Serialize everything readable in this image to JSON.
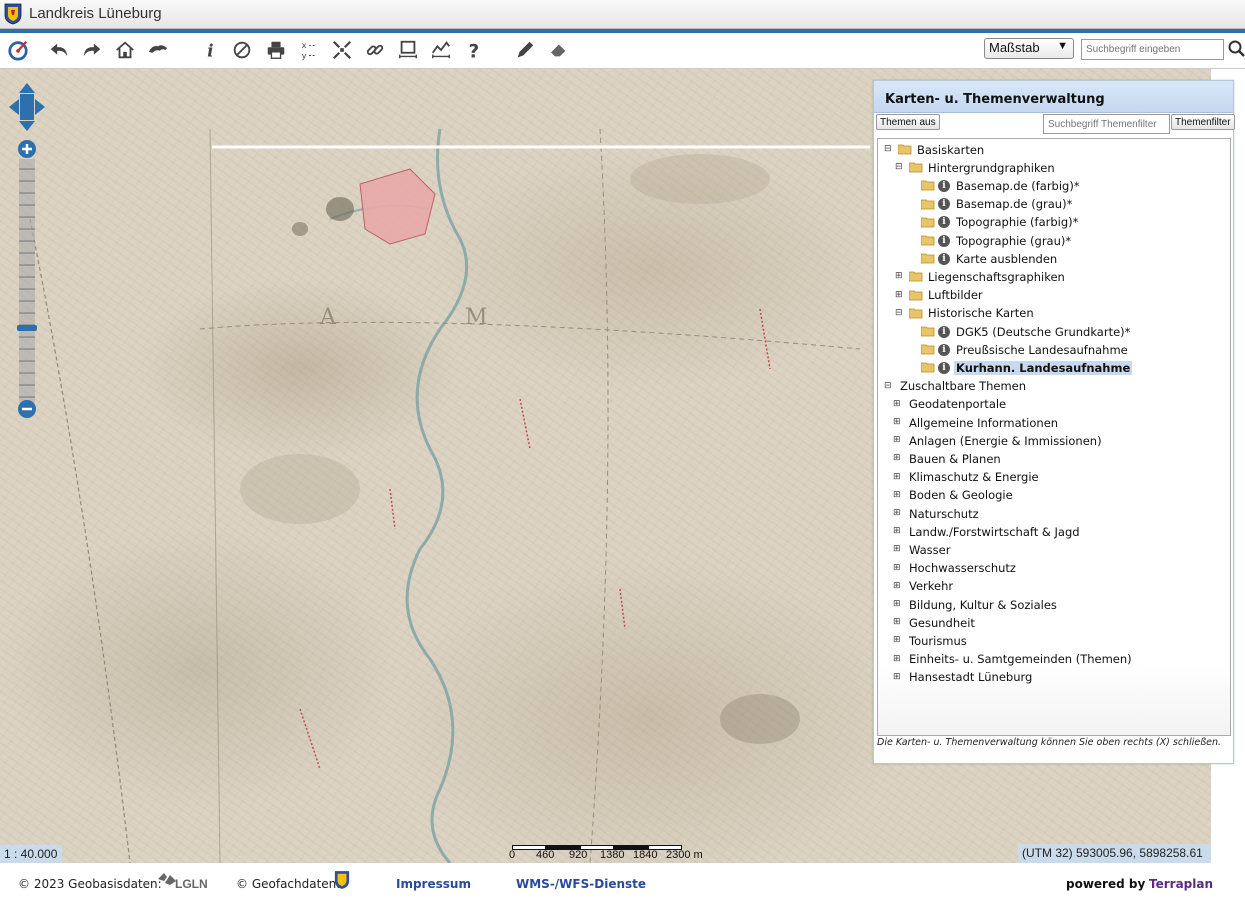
{
  "app": {
    "title": "Landkreis Lüneburg"
  },
  "toolbar": {
    "icons": [
      "logo-icon",
      "undo-icon",
      "redo-icon",
      "home-icon",
      "pan-icon",
      "info-icon",
      "clear-icon",
      "print-icon",
      "coordinates-icon",
      "fullextent-icon",
      "link-icon",
      "measure-area-icon",
      "measure-profile-icon",
      "help-icon",
      "draw-icon",
      "erase-icon"
    ],
    "scale_select": "Maßstab",
    "search_placeholder": "Suchbegriff eingeben"
  },
  "map": {
    "scale_ratio": "1 : 40.000",
    "coords": "(UTM 32) 593005.96, 5898258.61",
    "scalebar": {
      "labels": [
        "0",
        "460",
        "920",
        "1380",
        "1840",
        "2300 m"
      ]
    }
  },
  "panel": {
    "title": "Karten- u. Themenverwaltung",
    "btn_themes_off": "Themen aus",
    "filter_placeholder": "Suchbegriff Themenfilter",
    "btn_filter": "Themenfilter",
    "tree": [
      {
        "label": "Basiskarten"
      },
      {
        "label": "Hintergrundgraphiken"
      },
      {
        "label": "Basemap.de (farbig)*"
      },
      {
        "label": "Basemap.de (grau)*"
      },
      {
        "label": "Topographie (farbig)*"
      },
      {
        "label": "Topographie (grau)*"
      },
      {
        "label": "Karte ausblenden"
      },
      {
        "label": "Liegenschaftsgraphiken"
      },
      {
        "label": "Luftbilder"
      },
      {
        "label": "Historische Karten"
      },
      {
        "label": "DGK5 (Deutsche Grundkarte)*"
      },
      {
        "label": "Preußsische Landesaufnahme"
      },
      {
        "label": "Kurhann. Landesaufnahme"
      },
      {
        "label": "Zuschaltbare Themen"
      },
      {
        "label": "Geodatenportale"
      },
      {
        "label": "Allgemeine Informationen"
      },
      {
        "label": "Anlagen (Energie & Immissionen)"
      },
      {
        "label": "Bauen & Planen"
      },
      {
        "label": "Klimaschutz & Energie"
      },
      {
        "label": "Boden & Geologie"
      },
      {
        "label": "Naturschutz"
      },
      {
        "label": "Landw./Forstwirtschaft & Jagd"
      },
      {
        "label": "Wasser"
      },
      {
        "label": "Hochwasserschutz"
      },
      {
        "label": "Verkehr"
      },
      {
        "label": "Bildung, Kultur & Soziales"
      },
      {
        "label": "Gesundheit"
      },
      {
        "label": "Tourismus"
      },
      {
        "label": "Einheits- u. Samtgemeinden (Themen)"
      },
      {
        "label": "Hansestadt Lüneburg"
      }
    ],
    "note": "Die Karten- u. Themenverwaltung können Sie oben rechts (X) schließen."
  },
  "footer": {
    "geobasis": "© 2023 Geobasisdaten:",
    "lgln": "LGLN",
    "geofach": "© Geofachdaten:",
    "impressum": "Impressum",
    "wms": "WMS-/WFS-Dienste",
    "powered": "powered by",
    "brand": "Terraplan"
  },
  "colors": {
    "accent": "#2e6fae",
    "panel_header": "#c5d8f0",
    "link": "#2a4a9c",
    "brand": "#5b2a86"
  }
}
